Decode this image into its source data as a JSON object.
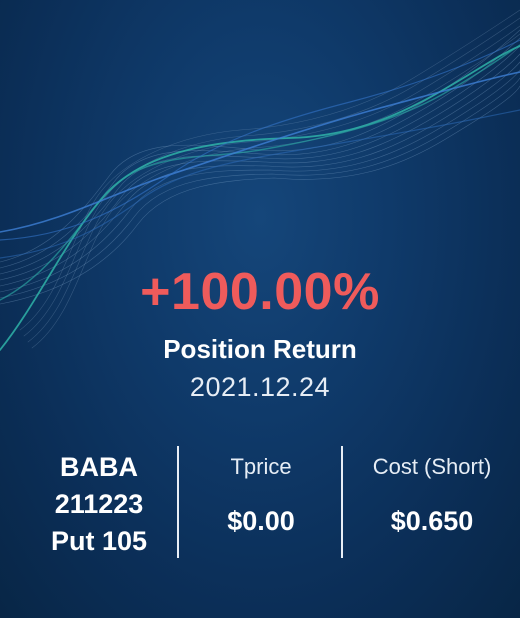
{
  "colors": {
    "positive_return": "#ef5b5b",
    "text_primary": "#ffffff",
    "background": "#0f3a6a",
    "wave_teal": "#2fb3a8",
    "wave_blue": "#3d7fd6"
  },
  "hero": {
    "return_value": "+100.00%",
    "return_label": "Position Return",
    "date": "2021.12.24"
  },
  "position": {
    "symbol_line1": "BABA",
    "symbol_line2": "211223",
    "symbol_line3": "Put 105",
    "tprice_label": "Tprice",
    "tprice_value": "$0.00",
    "cost_label": "Cost (Short)",
    "cost_value": "$0.650"
  }
}
